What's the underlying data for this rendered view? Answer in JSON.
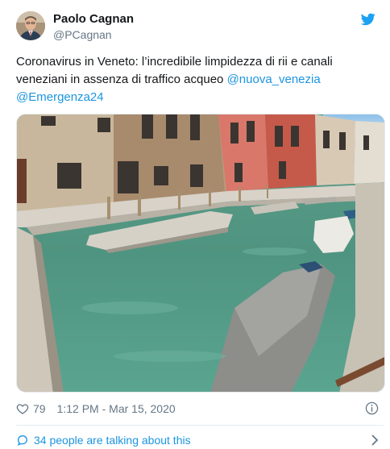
{
  "author": {
    "display_name": "Paolo Cagnan",
    "handle": "@PCagnan"
  },
  "tweet": {
    "text": "Coronavirus in Veneto: l’incredibile limpidezza di rii e canali veneziani in assenza di traffico acqueo ",
    "mention_1": "@nuova_venezia",
    "mention_2": "@Emergenza24"
  },
  "meta": {
    "likes": "79",
    "timestamp": "1:12 PM - Mar 15, 2020"
  },
  "conversation": {
    "label": "34 people are talking about this"
  },
  "icons": {
    "logo": "twitter-bird-icon",
    "like": "heart-icon",
    "info": "info-icon",
    "conversation": "speech-bubble-icon",
    "chevron": "chevron-right-icon"
  },
  "colors": {
    "link": "#1b95e0",
    "text": "#14171a",
    "muted": "#657786",
    "divider": "#e6ecf0"
  }
}
